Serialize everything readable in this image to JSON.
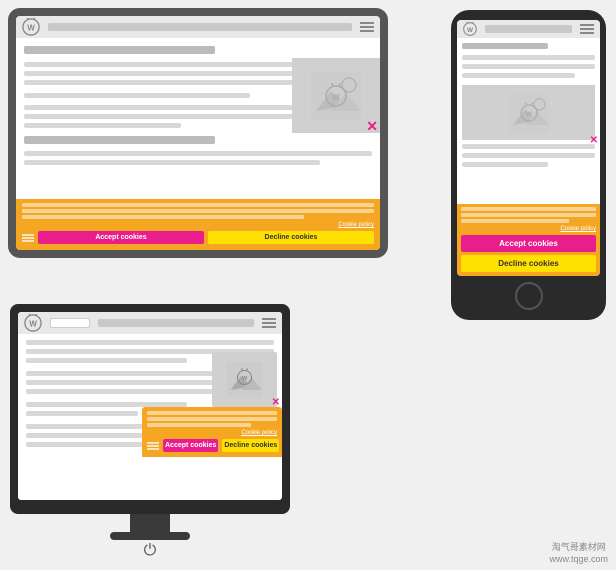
{
  "tablet": {
    "label": "Tablet device",
    "screen": {
      "nav": {
        "menu_icon_label": "menu"
      },
      "content_lines": [],
      "image_alt": "placeholder image with WordPress logo"
    }
  },
  "phone": {
    "label": "Phone device",
    "screen": {}
  },
  "monitor": {
    "label": "Desktop monitor",
    "screen": {}
  },
  "cookie_banner": {
    "accept_label": "Accept cookies",
    "decline_label": "Decline cookies",
    "policy_link": "Cookie policy",
    "settings_icon": "settings-icon"
  },
  "watermark": {
    "line1": "淘气哥素材网",
    "line2": "www.tqge.com"
  }
}
